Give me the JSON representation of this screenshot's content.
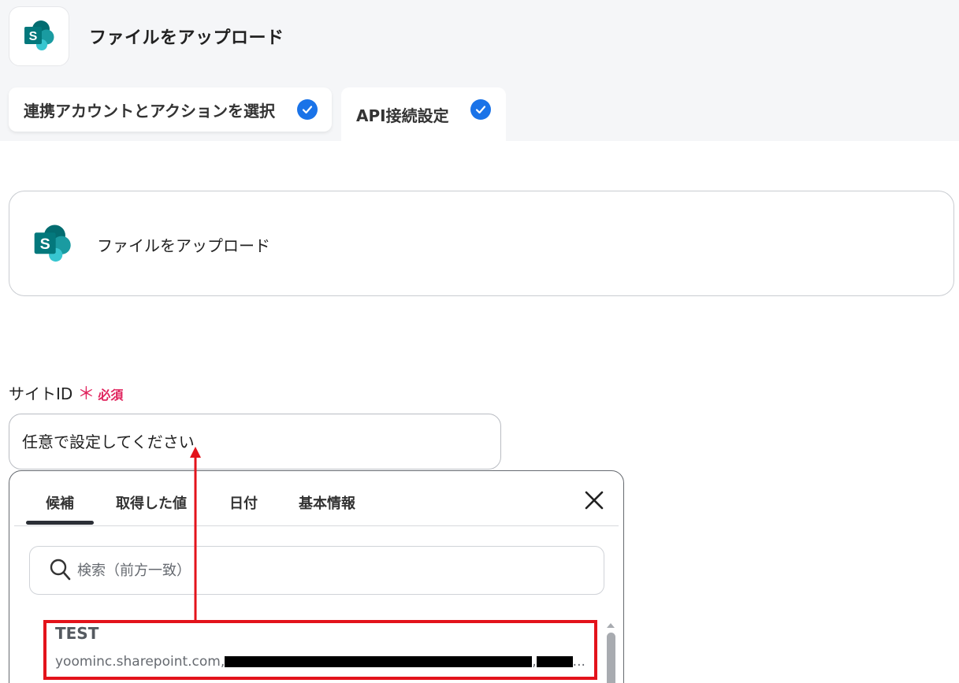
{
  "header": {
    "title": "ファイルをアップロード",
    "app_icon": "sharepoint-icon"
  },
  "steps": [
    {
      "label": "連携アカウントとアクションを選択",
      "status": "complete"
    },
    {
      "label": "API接続設定",
      "status": "complete"
    }
  ],
  "action_card": {
    "label": "ファイルをアップロード",
    "icon": "sharepoint-icon"
  },
  "field": {
    "label": "サイトID",
    "required_star": "＊",
    "required_text": "必須",
    "value": "任意で設定してください"
  },
  "popup": {
    "tabs": [
      "候補",
      "取得した値",
      "日付",
      "基本情報"
    ],
    "active_tab": "候補",
    "search_placeholder": "検索（前方一致）",
    "candidates": [
      {
        "title": "TEST",
        "subtitle_prefix": "yoominc.sharepoint.com,",
        "subtitle_sep": ",",
        "subtitle_suffix": "..."
      }
    ]
  },
  "colors": {
    "accent": "#1a73e8",
    "required": "#e0245e",
    "annotation": "#e3131b",
    "sharepoint_dark": "#036c70",
    "sharepoint_mid": "#1a9ba1",
    "sharepoint_light": "#37c6d0"
  }
}
